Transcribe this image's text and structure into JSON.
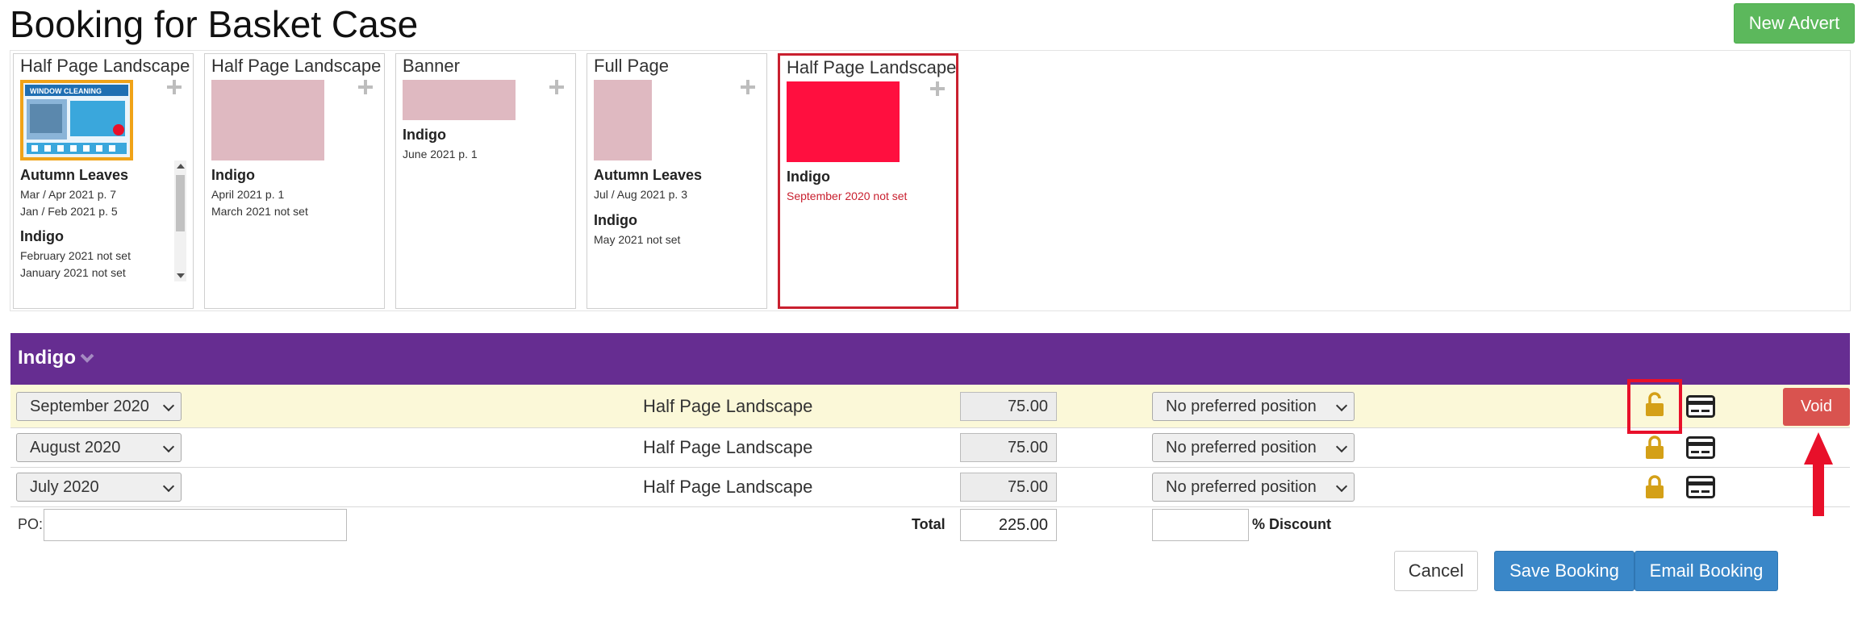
{
  "page": {
    "title": "Booking for Basket Case",
    "new_advert_label": "New Advert"
  },
  "adverts": [
    {
      "type": "Half Page Landscape",
      "thumb": "image",
      "publications": [
        {
          "name": "Autumn Leaves",
          "issues": [
            "Mar / Apr 2021 p. 7",
            "Jan / Feb 2021 p. 5"
          ]
        },
        {
          "name": "Indigo",
          "issues": [
            "February 2021 not set",
            "January 2021 not set"
          ]
        }
      ]
    },
    {
      "type": "Half Page Landscape",
      "publications": [
        {
          "name": "Indigo",
          "issues": [
            "April 2021 p. 1",
            "March 2021 not set"
          ]
        }
      ]
    },
    {
      "type": "Banner",
      "publications": [
        {
          "name": "Indigo",
          "issues": [
            "June 2021 p. 1"
          ]
        }
      ]
    },
    {
      "type": "Full Page",
      "publications": [
        {
          "name": "Autumn Leaves",
          "issues": [
            "Jul / Aug 2021 p. 3"
          ]
        },
        {
          "name": "Indigo",
          "issues": [
            "May 2021 not set"
          ]
        }
      ]
    },
    {
      "type": "Half Page Landscape",
      "selected": true,
      "publications": [
        {
          "name": "Indigo",
          "issues": [
            "September 2020 not set"
          ]
        }
      ]
    }
  ],
  "thumb_image": {
    "brand": "WINDOW CLEANING",
    "colors": {
      "frame": "#f0a318",
      "sky": "#8ab4d8",
      "panel": "#3aa7dc",
      "accent": "#e8102a"
    }
  },
  "section": {
    "title": "Indigo"
  },
  "booking_rows": [
    {
      "month": "September 2020",
      "ad_type": "Half Page Landscape",
      "price": "75.00",
      "position": "No preferred position",
      "locked": false,
      "action": "Void"
    },
    {
      "month": "August 2020",
      "ad_type": "Half Page Landscape",
      "price": "75.00",
      "position": "No preferred position",
      "locked": true
    },
    {
      "month": "July 2020",
      "ad_type": "Half Page Landscape",
      "price": "75.00",
      "position": "No preferred position",
      "locked": true
    }
  ],
  "footer": {
    "po_label": "PO:",
    "po_value": "",
    "total_label": "Total",
    "total_value": "225.00",
    "discount_value": "",
    "discount_label": "% Discount",
    "cancel_label": "Cancel",
    "save_label": "Save Booking",
    "email_label": "Email Booking"
  },
  "colors": {
    "section_bar": "#662d91",
    "selected_border": "#c9202f",
    "selected_thumb": "#ff0f3f",
    "thumb_placeholder": "#dfb9c1",
    "lock_icon": "#d4a017",
    "void_button": "#d9534f",
    "primary_button": "#3a87c8",
    "success_button": "#5cb85c",
    "highlight_row": "#fbf8d8",
    "annotation": "#e8102a"
  }
}
